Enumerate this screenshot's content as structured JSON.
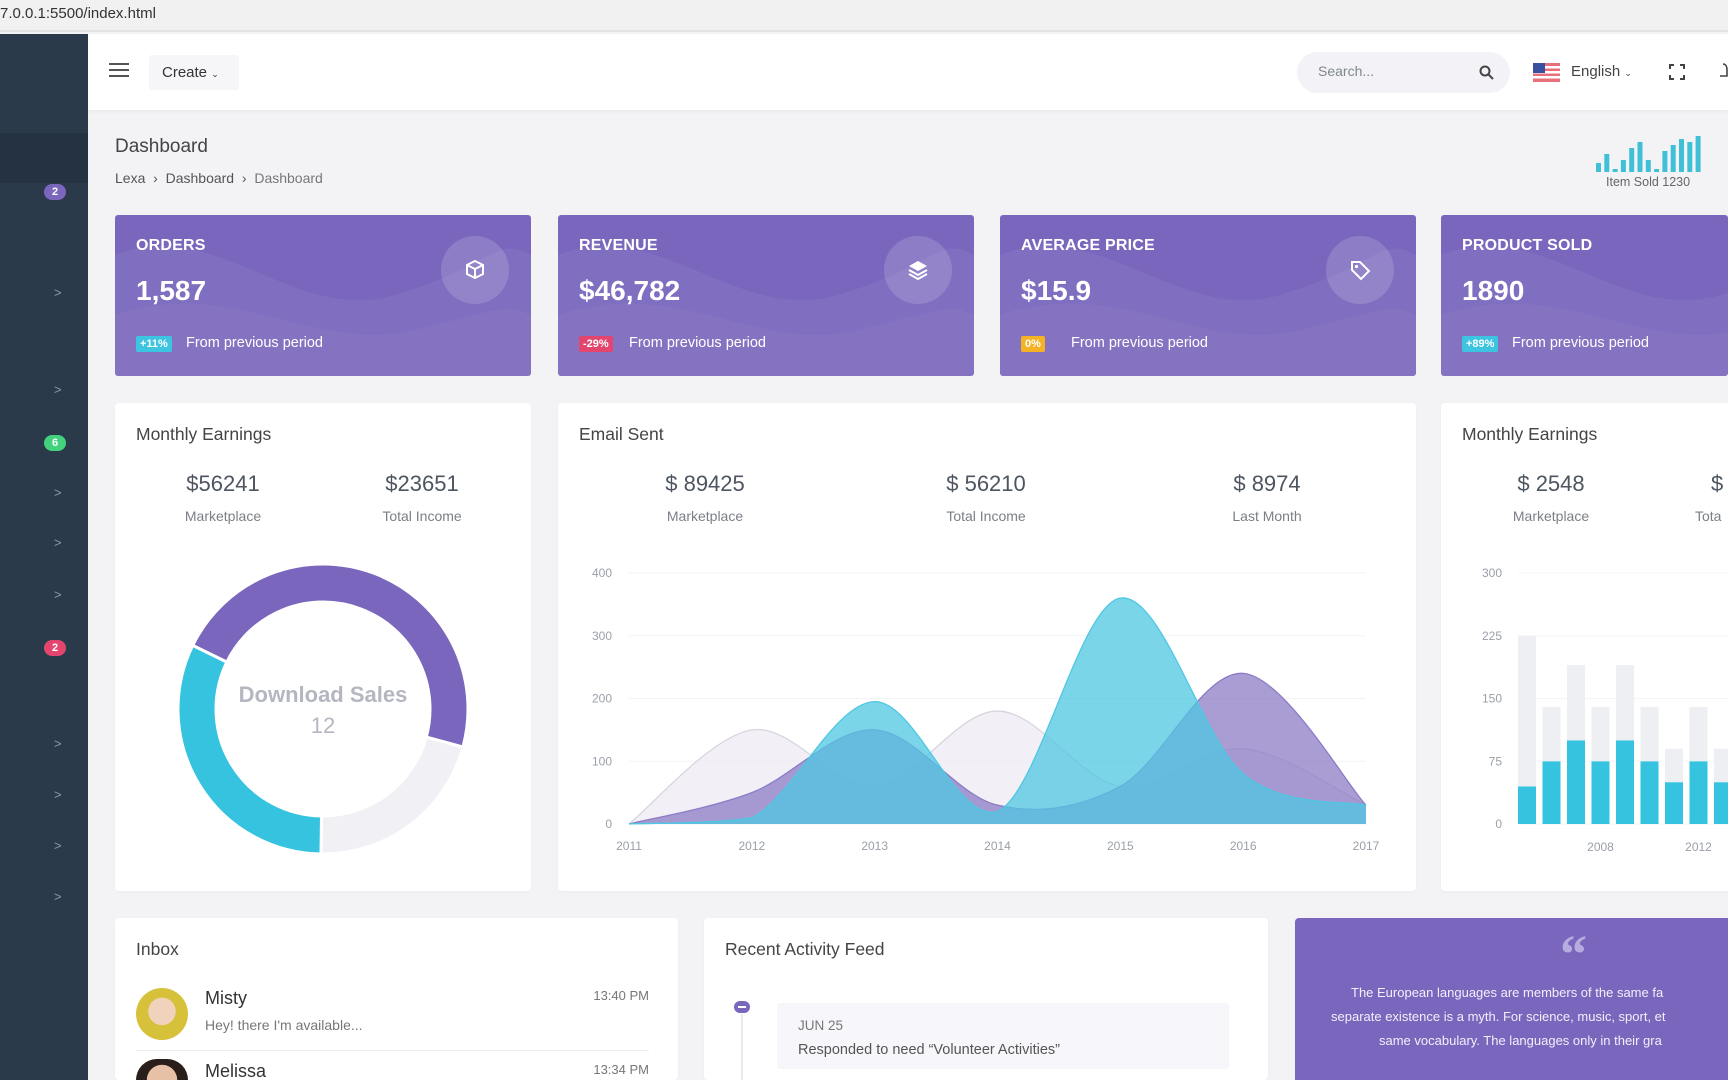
{
  "browser": {
    "url": "7.0.0.1:5500/index.html"
  },
  "sidebar": {
    "badges": [
      {
        "value": "2",
        "color": "#7a67bd"
      },
      {
        "value": "6",
        "color": "#42d27e"
      },
      {
        "value": "2",
        "color": "#e2466e"
      }
    ],
    "chevron": ">"
  },
  "header": {
    "create_label": "Create",
    "search_placeholder": "Search...",
    "language": "English",
    "icons": [
      "menu-icon",
      "search-icon",
      "us-flag-icon",
      "fullscreen-icon",
      "bell-icon"
    ]
  },
  "page": {
    "title": "Dashboard",
    "breadcrumb": [
      "Lexa",
      "Dashboard",
      "Dashboard"
    ],
    "item_sold_label": "Item Sold 1230",
    "sparkline": [
      3,
      6,
      1,
      4,
      8,
      10,
      4,
      1,
      7,
      9,
      11,
      10,
      12
    ]
  },
  "stats": [
    {
      "title": "ORDERS",
      "value": "1,587",
      "badge": "+11%",
      "badge_color": "#3cc4e0",
      "note": "From previous period",
      "icon": "cube-icon"
    },
    {
      "title": "REVENUE",
      "value": "$46,782",
      "badge": "-29%",
      "badge_color": "#e2466e",
      "note": "From previous period",
      "icon": "layers-icon"
    },
    {
      "title": "AVERAGE PRICE",
      "value": "$15.9",
      "badge": "0%",
      "badge_color": "#f5b225",
      "note": "From previous period",
      "icon": "tag-icon"
    },
    {
      "title": "PRODUCT SOLD",
      "value": "1890",
      "badge": "+89%",
      "badge_color": "#3cc4e0",
      "note": "From previous period",
      "icon": "cart-icon"
    }
  ],
  "monthly_earnings": {
    "title": "Monthly Earnings",
    "values": [
      {
        "value": "$56241",
        "label": "Marketplace"
      },
      {
        "value": "$23651",
        "label": "Total Income"
      }
    ],
    "donut_label": "Download Sales",
    "donut_value": "12"
  },
  "email_sent": {
    "title": "Email Sent",
    "values": [
      {
        "value": "$ 89425",
        "label": "Marketplace"
      },
      {
        "value": "$ 56210",
        "label": "Total Income"
      },
      {
        "value": "$ 8974",
        "label": "Last Month"
      }
    ]
  },
  "monthly_earnings_2": {
    "title": "Monthly Earnings",
    "values": [
      {
        "value": "$ 2548",
        "label": "Marketplace"
      },
      {
        "value": "$",
        "label": "Tota"
      }
    ]
  },
  "chart_data": [
    {
      "type": "pie",
      "donut": true,
      "values": [
        47,
        21,
        32
      ],
      "colors": [
        "#7a67bd",
        "#f0f0f5",
        "#35c3df"
      ]
    },
    {
      "type": "area",
      "x": [
        "2011",
        "2012",
        "2013",
        "2014",
        "2015",
        "2016",
        "2017"
      ],
      "ylim": [
        0,
        400
      ],
      "yticks": [
        0,
        100,
        200,
        300,
        400
      ],
      "series": [
        {
          "color": "#ece9f2",
          "values": [
            0,
            150,
            60,
            180,
            60,
            120,
            30
          ]
        },
        {
          "color": "#8c7cc6",
          "values": [
            0,
            50,
            150,
            30,
            60,
            240,
            30
          ]
        },
        {
          "color": "#4fc7e2",
          "values": [
            0,
            10,
            195,
            20,
            360,
            80,
            30
          ]
        }
      ]
    },
    {
      "type": "bar",
      "stacked": true,
      "categories": [
        "2005",
        "2006",
        "2007",
        "2008",
        "2009",
        "2010",
        "2011",
        "2012",
        "2013"
      ],
      "xticks": [
        "2008",
        "2012"
      ],
      "ylim": [
        0,
        300
      ],
      "yticks": [
        0,
        75,
        150,
        225,
        300
      ],
      "series": [
        {
          "color": "#35c3df",
          "values": [
            45,
            75,
            100,
            75,
            100,
            75,
            50,
            75,
            50
          ]
        },
        {
          "color": "#eeeff3",
          "values": [
            180,
            65,
            90,
            65,
            90,
            65,
            40,
            65,
            40
          ]
        }
      ]
    }
  ],
  "inbox": {
    "title": "Inbox",
    "items": [
      {
        "name": "Misty",
        "message": "Hey! there I'm available...",
        "time": "13:40 PM"
      },
      {
        "name": "Melissa",
        "time": "13:34 PM"
      }
    ]
  },
  "activity": {
    "title": "Recent Activity Feed",
    "items": [
      {
        "date": "JUN 25",
        "text": "Responded to need “Volunteer Activities”"
      }
    ]
  },
  "quote": {
    "lines": [
      "The European languages are members of the same fa",
      "separate existence is a myth. For science, music, sport, et",
      "same vocabulary. The languages only in their gra"
    ]
  }
}
